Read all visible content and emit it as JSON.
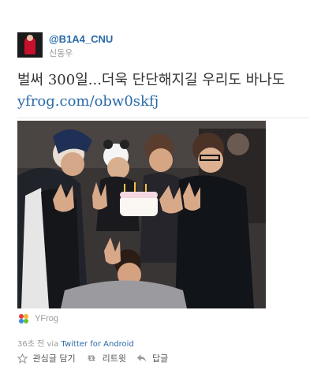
{
  "tweet": {
    "handle": "@B1A4_CNU",
    "display_name": "신동우",
    "text": "벌써 300일...더욱 단단해지길 우리도 바나도",
    "link": "yfrog.com/obw0skfj",
    "media_source": "YFrog",
    "timestamp": "36초 전",
    "via_prefix": "via",
    "client": "Twitter for Android"
  },
  "actions": {
    "favorite": "관심글 담기",
    "retweet": "리트윗",
    "reply": "답글"
  },
  "colors": {
    "link": "#2a6aa8",
    "muted": "#999999",
    "text": "#333333"
  },
  "icons": {
    "avatar": "profile-photo",
    "media_logo": "yfrog-logo",
    "favorite": "star-icon",
    "retweet": "retweet-icon",
    "reply": "reply-icon"
  }
}
